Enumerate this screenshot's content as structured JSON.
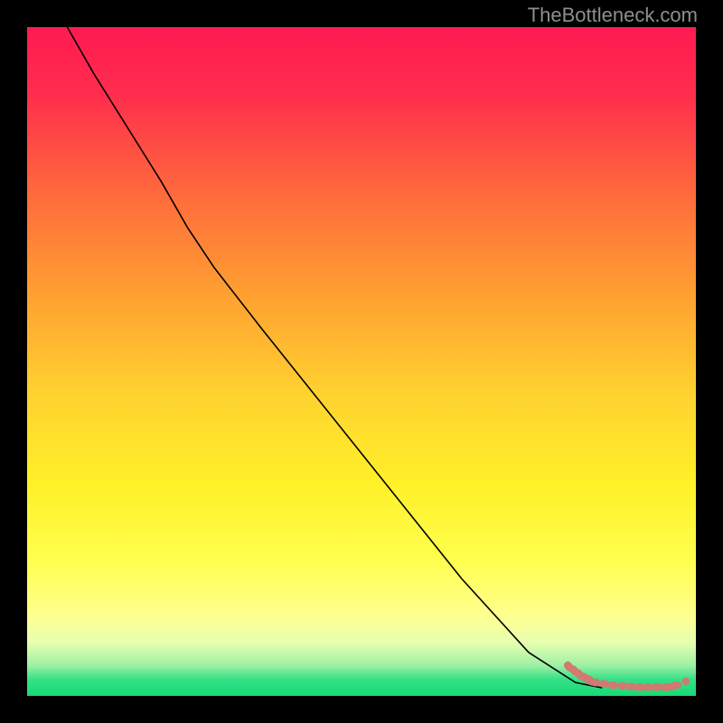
{
  "watermark": "TheBottleneck.com",
  "gradient_stops": [
    {
      "offset": 0.0,
      "color": "#ff1a52"
    },
    {
      "offset": 0.1,
      "color": "#ff2d4d"
    },
    {
      "offset": 0.25,
      "color": "#ff6a3c"
    },
    {
      "offset": 0.4,
      "color": "#ffa031"
    },
    {
      "offset": 0.55,
      "color": "#ffd230"
    },
    {
      "offset": 0.68,
      "color": "#fff028"
    },
    {
      "offset": 0.8,
      "color": "#ffff50"
    },
    {
      "offset": 0.88,
      "color": "#ffff90"
    },
    {
      "offset": 0.92,
      "color": "#e8ffb0"
    },
    {
      "offset": 0.955,
      "color": "#9cf0a4"
    },
    {
      "offset": 0.975,
      "color": "#36e186"
    },
    {
      "offset": 1.0,
      "color": "#17d977"
    }
  ],
  "chart_data": {
    "type": "line",
    "title": "",
    "xlabel": "",
    "ylabel": "",
    "xlim": [
      0,
      100
    ],
    "ylim": [
      0,
      100
    ],
    "legend": false,
    "grid": false,
    "series": [
      {
        "name": "curve",
        "stroke": "#000000",
        "stroke_width": 1.6,
        "x": [
          6,
          10,
          15,
          20,
          24,
          28,
          35,
          45,
          55,
          65,
          75,
          82,
          86
        ],
        "y": [
          100,
          93,
          85,
          77,
          70,
          64,
          55,
          42.5,
          30,
          17.5,
          6.5,
          2.0,
          1.2
        ]
      }
    ],
    "marker_series": {
      "name": "flat-region-markers",
      "color": "#d07a70",
      "radius_step": 4.5,
      "radius_dash": 4.2,
      "type_sequence": [
        "step",
        "step",
        "step",
        "step",
        "step",
        "dash",
        "dash",
        "dash",
        "dash",
        "dash",
        "dash",
        "dash",
        "dash",
        "dash",
        "dash",
        "dash",
        "dot"
      ],
      "x": [
        81.0,
        81.8,
        82.6,
        83.4,
        84.2,
        85.0,
        86.3,
        87.6,
        89.0,
        90.3,
        91.6,
        92.9,
        94.2,
        95.5,
        96.3,
        97.1,
        98.5
      ],
      "y": [
        4.4,
        3.8,
        3.2,
        2.7,
        2.3,
        2.0,
        1.8,
        1.6,
        1.5,
        1.4,
        1.3,
        1.3,
        1.3,
        1.3,
        1.4,
        1.6,
        2.2
      ]
    }
  }
}
